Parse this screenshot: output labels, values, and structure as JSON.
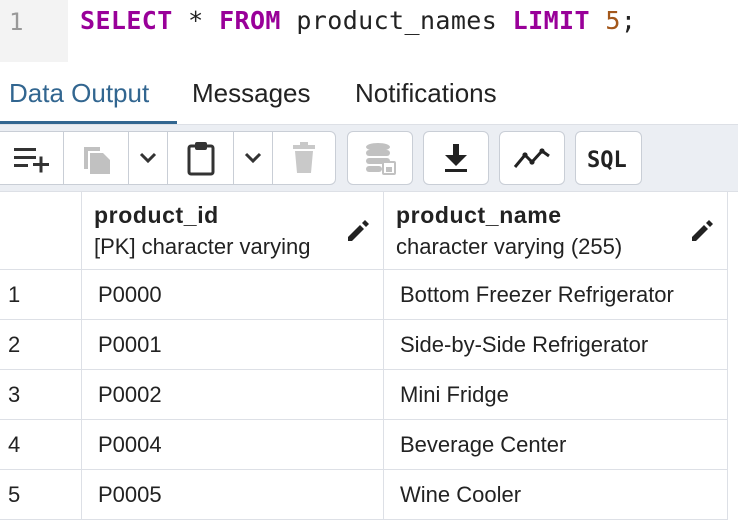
{
  "editor": {
    "line_number": "1",
    "tokens": {
      "select": "SELECT",
      "star": " * ",
      "from": "FROM",
      "table": " product_names ",
      "limit": "LIMIT",
      "space": " ",
      "count": "5",
      "semicolon": ";"
    }
  },
  "tabs": [
    {
      "label": "Data Output",
      "active": true
    },
    {
      "label": "Messages",
      "active": false
    },
    {
      "label": "Notifications",
      "active": false
    }
  ],
  "toolbar": {
    "buttons": [
      {
        "icon": "add-row-icon"
      },
      {
        "icon": "copy-icon"
      },
      {
        "icon": "chevron-down-icon"
      },
      {
        "icon": "paste-icon"
      },
      {
        "icon": "chevron-down-icon"
      },
      {
        "icon": "delete-icon"
      },
      {
        "icon": "save-data-icon"
      },
      {
        "icon": "download-icon"
      },
      {
        "icon": "graph-icon"
      },
      {
        "icon": "sql-icon",
        "label": "SQL"
      }
    ]
  },
  "grid": {
    "columns": [
      {
        "name": "product_id",
        "type": "[PK] character varying"
      },
      {
        "name": "product_name",
        "type": "character varying (255)"
      }
    ],
    "rows": [
      {
        "num": "1",
        "product_id": "P0000",
        "product_name": "Bottom Freezer Refrigerator"
      },
      {
        "num": "2",
        "product_id": "P0001",
        "product_name": "Side-by-Side Refrigerator"
      },
      {
        "num": "3",
        "product_id": "P0002",
        "product_name": "Mini Fridge"
      },
      {
        "num": "4",
        "product_id": "P0004",
        "product_name": "Beverage Center"
      },
      {
        "num": "5",
        "product_id": "P0005",
        "product_name": "Wine Cooler"
      }
    ]
  },
  "colors": {
    "keyword": "#990099",
    "number": "#a3571b",
    "active_tab": "#326690",
    "toolbar_bg": "#ebeef3",
    "grid_border": "#dde0e6"
  }
}
